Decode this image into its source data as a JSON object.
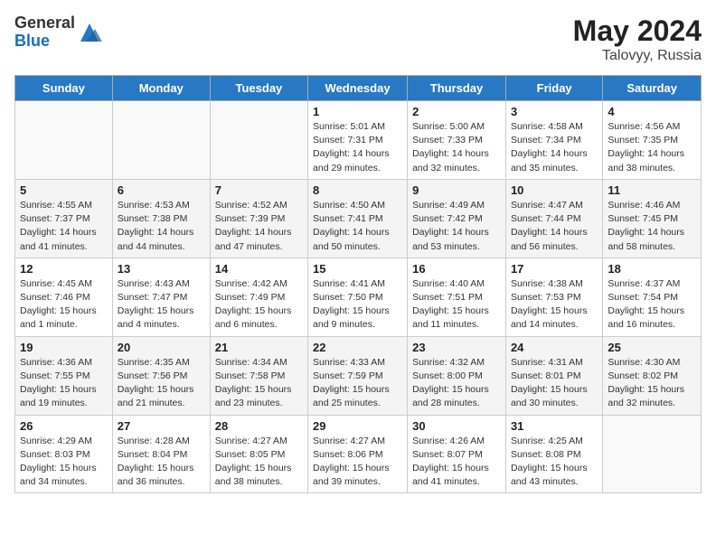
{
  "header": {
    "logo_general": "General",
    "logo_blue": "Blue",
    "month_year": "May 2024",
    "location": "Talovyy, Russia"
  },
  "days_of_week": [
    "Sunday",
    "Monday",
    "Tuesday",
    "Wednesday",
    "Thursday",
    "Friday",
    "Saturday"
  ],
  "weeks": [
    [
      {
        "num": "",
        "info": ""
      },
      {
        "num": "",
        "info": ""
      },
      {
        "num": "",
        "info": ""
      },
      {
        "num": "1",
        "info": "Sunrise: 5:01 AM\nSunset: 7:31 PM\nDaylight: 14 hours\nand 29 minutes."
      },
      {
        "num": "2",
        "info": "Sunrise: 5:00 AM\nSunset: 7:33 PM\nDaylight: 14 hours\nand 32 minutes."
      },
      {
        "num": "3",
        "info": "Sunrise: 4:58 AM\nSunset: 7:34 PM\nDaylight: 14 hours\nand 35 minutes."
      },
      {
        "num": "4",
        "info": "Sunrise: 4:56 AM\nSunset: 7:35 PM\nDaylight: 14 hours\nand 38 minutes."
      }
    ],
    [
      {
        "num": "5",
        "info": "Sunrise: 4:55 AM\nSunset: 7:37 PM\nDaylight: 14 hours\nand 41 minutes."
      },
      {
        "num": "6",
        "info": "Sunrise: 4:53 AM\nSunset: 7:38 PM\nDaylight: 14 hours\nand 44 minutes."
      },
      {
        "num": "7",
        "info": "Sunrise: 4:52 AM\nSunset: 7:39 PM\nDaylight: 14 hours\nand 47 minutes."
      },
      {
        "num": "8",
        "info": "Sunrise: 4:50 AM\nSunset: 7:41 PM\nDaylight: 14 hours\nand 50 minutes."
      },
      {
        "num": "9",
        "info": "Sunrise: 4:49 AM\nSunset: 7:42 PM\nDaylight: 14 hours\nand 53 minutes."
      },
      {
        "num": "10",
        "info": "Sunrise: 4:47 AM\nSunset: 7:44 PM\nDaylight: 14 hours\nand 56 minutes."
      },
      {
        "num": "11",
        "info": "Sunrise: 4:46 AM\nSunset: 7:45 PM\nDaylight: 14 hours\nand 58 minutes."
      }
    ],
    [
      {
        "num": "12",
        "info": "Sunrise: 4:45 AM\nSunset: 7:46 PM\nDaylight: 15 hours\nand 1 minute."
      },
      {
        "num": "13",
        "info": "Sunrise: 4:43 AM\nSunset: 7:47 PM\nDaylight: 15 hours\nand 4 minutes."
      },
      {
        "num": "14",
        "info": "Sunrise: 4:42 AM\nSunset: 7:49 PM\nDaylight: 15 hours\nand 6 minutes."
      },
      {
        "num": "15",
        "info": "Sunrise: 4:41 AM\nSunset: 7:50 PM\nDaylight: 15 hours\nand 9 minutes."
      },
      {
        "num": "16",
        "info": "Sunrise: 4:40 AM\nSunset: 7:51 PM\nDaylight: 15 hours\nand 11 minutes."
      },
      {
        "num": "17",
        "info": "Sunrise: 4:38 AM\nSunset: 7:53 PM\nDaylight: 15 hours\nand 14 minutes."
      },
      {
        "num": "18",
        "info": "Sunrise: 4:37 AM\nSunset: 7:54 PM\nDaylight: 15 hours\nand 16 minutes."
      }
    ],
    [
      {
        "num": "19",
        "info": "Sunrise: 4:36 AM\nSunset: 7:55 PM\nDaylight: 15 hours\nand 19 minutes."
      },
      {
        "num": "20",
        "info": "Sunrise: 4:35 AM\nSunset: 7:56 PM\nDaylight: 15 hours\nand 21 minutes."
      },
      {
        "num": "21",
        "info": "Sunrise: 4:34 AM\nSunset: 7:58 PM\nDaylight: 15 hours\nand 23 minutes."
      },
      {
        "num": "22",
        "info": "Sunrise: 4:33 AM\nSunset: 7:59 PM\nDaylight: 15 hours\nand 25 minutes."
      },
      {
        "num": "23",
        "info": "Sunrise: 4:32 AM\nSunset: 8:00 PM\nDaylight: 15 hours\nand 28 minutes."
      },
      {
        "num": "24",
        "info": "Sunrise: 4:31 AM\nSunset: 8:01 PM\nDaylight: 15 hours\nand 30 minutes."
      },
      {
        "num": "25",
        "info": "Sunrise: 4:30 AM\nSunset: 8:02 PM\nDaylight: 15 hours\nand 32 minutes."
      }
    ],
    [
      {
        "num": "26",
        "info": "Sunrise: 4:29 AM\nSunset: 8:03 PM\nDaylight: 15 hours\nand 34 minutes."
      },
      {
        "num": "27",
        "info": "Sunrise: 4:28 AM\nSunset: 8:04 PM\nDaylight: 15 hours\nand 36 minutes."
      },
      {
        "num": "28",
        "info": "Sunrise: 4:27 AM\nSunset: 8:05 PM\nDaylight: 15 hours\nand 38 minutes."
      },
      {
        "num": "29",
        "info": "Sunrise: 4:27 AM\nSunset: 8:06 PM\nDaylight: 15 hours\nand 39 minutes."
      },
      {
        "num": "30",
        "info": "Sunrise: 4:26 AM\nSunset: 8:07 PM\nDaylight: 15 hours\nand 41 minutes."
      },
      {
        "num": "31",
        "info": "Sunrise: 4:25 AM\nSunset: 8:08 PM\nDaylight: 15 hours\nand 43 minutes."
      },
      {
        "num": "",
        "info": ""
      }
    ]
  ]
}
